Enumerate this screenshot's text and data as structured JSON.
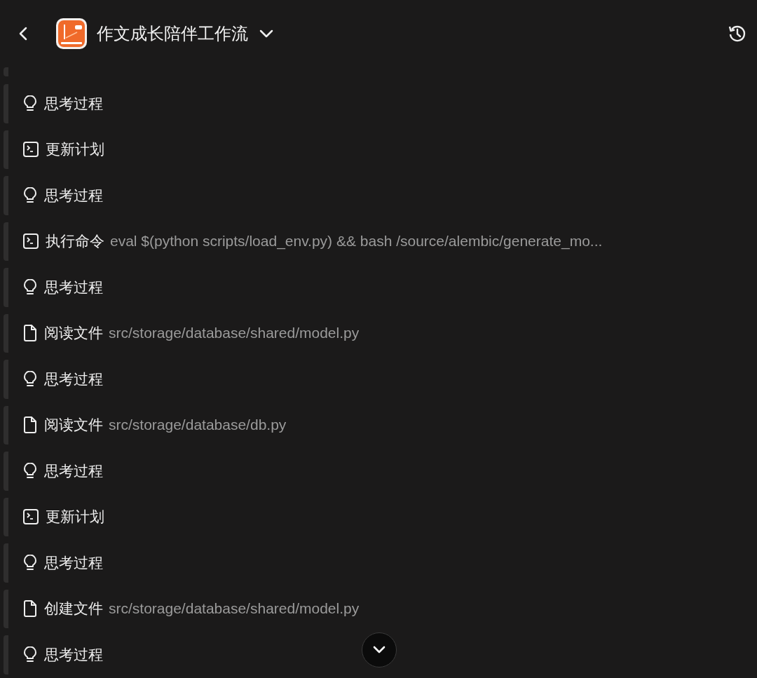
{
  "header": {
    "title": "作文成长陪伴工作流"
  },
  "steps": [
    {
      "kind": "think",
      "label": "思考过程"
    },
    {
      "kind": "terminal",
      "label": "更新计划"
    },
    {
      "kind": "think",
      "label": "思考过程"
    },
    {
      "kind": "terminal",
      "label": "执行命令",
      "detail": "eval $(python scripts/load_env.py) && bash /source/alembic/generate_mo..."
    },
    {
      "kind": "think",
      "label": "思考过程"
    },
    {
      "kind": "file",
      "label": "阅读文件",
      "detail": "src/storage/database/shared/model.py"
    },
    {
      "kind": "think",
      "label": "思考过程"
    },
    {
      "kind": "file",
      "label": "阅读文件",
      "detail": "src/storage/database/db.py"
    },
    {
      "kind": "think",
      "label": "思考过程"
    },
    {
      "kind": "terminal",
      "label": "更新计划"
    },
    {
      "kind": "think",
      "label": "思考过程"
    },
    {
      "kind": "file",
      "label": "创建文件",
      "detail": "src/storage/database/shared/model.py"
    },
    {
      "kind": "think",
      "label": "思考过程"
    }
  ]
}
